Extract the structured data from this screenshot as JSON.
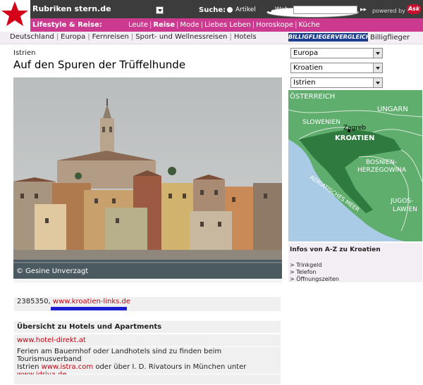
{
  "header": {
    "rubriken_label": "Rubriken stern.de",
    "search_label": "Suche:",
    "search_options": [
      "Artikel",
      "Web"
    ],
    "search_value": "",
    "go_label": "▸▸",
    "powered_label": "powered by",
    "ask_logo_text": "Ask"
  },
  "nav": {
    "section": "Lifestyle & Reise:",
    "items": [
      "Leute",
      "Reise",
      "Mode",
      "Liebes Leben",
      "Horoskope",
      "Küche"
    ]
  },
  "subnav": {
    "items": [
      "Deutschland",
      "Europa",
      "Fernreisen",
      "Sport- und Wellnessreisen",
      "Hotels"
    ],
    "billigflieger_logo": "BILLIGFLIEGERVERGLEICH",
    "billigflieger_text": "Billigflieger"
  },
  "article": {
    "kicker": "Istrien",
    "title": "Auf den Spuren der Trüffelhunde",
    "photo_credit": "© Gesine Unverzagt"
  },
  "sidebar": {
    "selects": [
      "Europa",
      "Kroatien",
      "Istrien"
    ],
    "map_labels": {
      "oesterreich": "ÖSTERREICH",
      "ungarn": "UNGARN",
      "slowenien": "SLOWENIEN",
      "zagreb": "Zagreb",
      "kroatien": "KROATIEN",
      "bosnien1": "BOSNIEN-",
      "bosnien2": "HERZEGOWINA",
      "jugos1": "JUGOS-",
      "jugos2": "LAWIEN",
      "adria": "ADRIATISCHES MEER"
    },
    "info_title": "Infos von A-Z zu Kroatien",
    "info_items": [
      "> Trinkgeld",
      "> Telefon",
      "> Öffnungszeiten"
    ]
  },
  "links": {
    "phone_prefix": "2385350,",
    "kroatien_link": "www.kroatien-links.de",
    "hotels_heading": "Übersicht zu Hotels und Apartments",
    "hotel_link": "www.hotel-direkt.at",
    "para_part1": "Ferien am Bauernhof oder Landhotels sind zu finden beim Tourismusverband",
    "para_istrien": "Istrien",
    "istra_link": "www.istra.com",
    "para_part2": "oder über I. D. Rivatours in München unter",
    "idriva_link": "www.idriva.de"
  },
  "colors": {
    "topbar": "#3c3c3c",
    "nav_magenta": "#cb3a8e",
    "link_red": "#c00010",
    "map_land": "#5fae6e",
    "map_sea": "#a9cbe6"
  }
}
